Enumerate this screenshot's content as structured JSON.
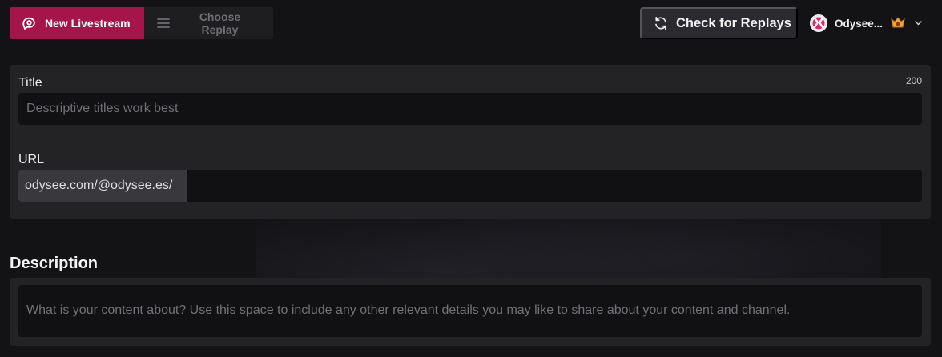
{
  "tabs": [
    {
      "label": "New Livestream",
      "icon": "livestream-icon",
      "active": true
    },
    {
      "label": "Choose Replay",
      "icon": "list-icon",
      "active": false
    }
  ],
  "header": {
    "check_replays_label": "Check for Replays",
    "check_replays_icon": "refresh-icon",
    "channel": {
      "name": "Odysee...",
      "avatar_icon": "odysee-avatar-icon",
      "badge_icon": "premium-badge-icon",
      "dropdown_icon": "chevron-down-icon"
    }
  },
  "form": {
    "title_label": "Title",
    "title_char_limit": "200",
    "title_placeholder": "Descriptive titles work best",
    "url_label": "URL",
    "url_prefix": "odysee.com/@odysee.es/",
    "url_value": ""
  },
  "description": {
    "heading": "Description",
    "placeholder": "What is your content about? Use this space to include any other relevant details you may like to share about your content and channel."
  },
  "colors": {
    "accent": "#a5154a",
    "background": "#131316",
    "card": "#232326",
    "input": "#111113"
  }
}
